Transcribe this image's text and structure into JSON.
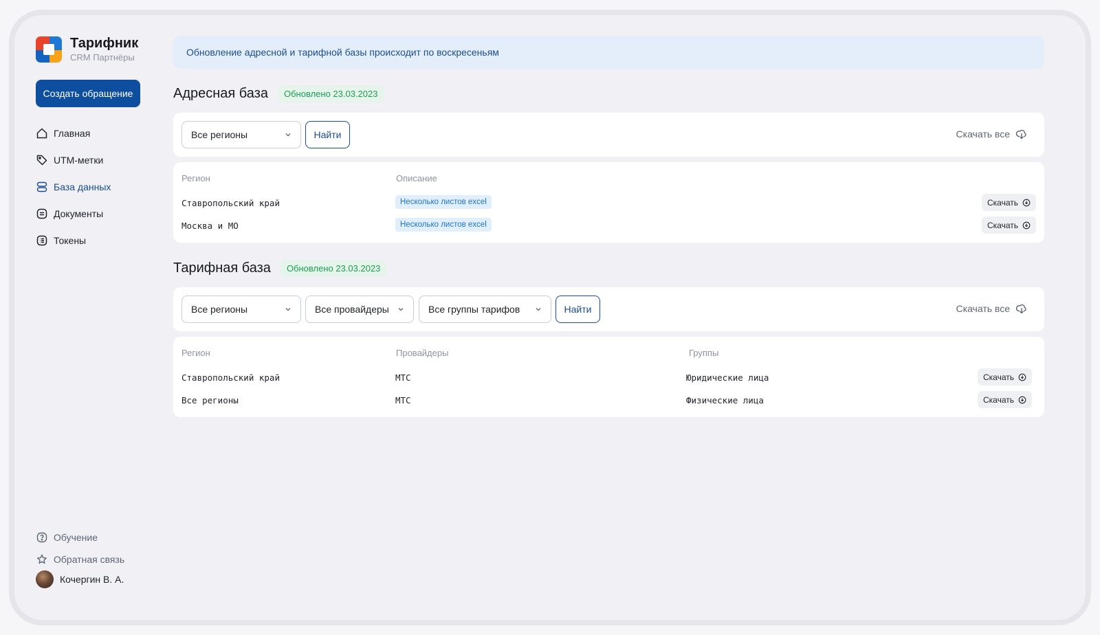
{
  "brand": {
    "title": "Тарифник",
    "subtitle": "CRM Партнёры"
  },
  "sidebar": {
    "create_button": "Создать обращение",
    "items": [
      {
        "label": "Главная",
        "icon": "home-icon"
      },
      {
        "label": "UTM-метки",
        "icon": "tag-icon"
      },
      {
        "label": "База данных",
        "icon": "database-icon",
        "active": true
      },
      {
        "label": "Документы",
        "icon": "document-icon"
      },
      {
        "label": "Токены",
        "icon": "list-icon"
      }
    ],
    "bottom_items": [
      {
        "label": "Обучение",
        "icon": "help-circle-icon"
      },
      {
        "label": "Обратная связь",
        "icon": "star-icon"
      }
    ],
    "user": {
      "name": "Кочергин В. А."
    }
  },
  "banner": {
    "text": "Обновление адресной и тарифной базы происходит по воскресеньям"
  },
  "address_base": {
    "title": "Адресная база",
    "updated": "Обновлено 23.03.2023",
    "filters": {
      "region": "Все регионы",
      "find": "Найти",
      "download_all": "Скачать все"
    },
    "columns": [
      "Регион",
      "Описание"
    ],
    "rows": [
      {
        "region": "Ставропольский край",
        "description": "Несколько листов excel",
        "action": "Скачать"
      },
      {
        "region": "Москва и МО",
        "description": "Несколько листов excel",
        "action": "Скачать"
      }
    ]
  },
  "tariff_base": {
    "title": "Тарифная база",
    "updated": "Обновлено 23.03.2023",
    "filters": {
      "region": "Все регионы",
      "providers": "Все провайдеры",
      "groups": "Все группы тарифов",
      "find": "Найти",
      "download_all": "Скачать все"
    },
    "columns": [
      "Регион",
      "Провайдеры",
      "Группы"
    ],
    "rows": [
      {
        "region": "Ставропольский край",
        "provider": "МТС",
        "group": "Юридические лица",
        "action": "Скачать"
      },
      {
        "region": "Все регионы",
        "provider": "МТС",
        "group": "Физические лица",
        "action": "Скачать"
      }
    ]
  },
  "colors": {
    "primary": "#0d4f9e",
    "accent_text": "#1a4b8e",
    "updated_green": "#1f9a55",
    "banner_bg": "#e3eefa",
    "tag_bg": "#e1effc"
  }
}
